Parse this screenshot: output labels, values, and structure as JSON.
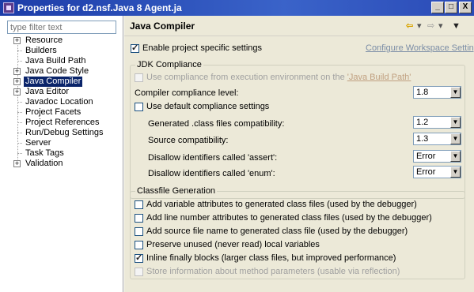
{
  "window": {
    "title": "Properties for d2.nsf.Java 8 Agent.ja",
    "buttons": {
      "minimize": "_",
      "maximize": "□",
      "close": "X"
    }
  },
  "left": {
    "filter_placeholder": "type filter text",
    "tree": [
      {
        "label": "Resource",
        "expandable": true,
        "selected": false
      },
      {
        "label": "Builders",
        "expandable": false,
        "selected": false
      },
      {
        "label": "Java Build Path",
        "expandable": false,
        "selected": false
      },
      {
        "label": "Java Code Style",
        "expandable": true,
        "selected": false
      },
      {
        "label": "Java Compiler",
        "expandable": true,
        "selected": true
      },
      {
        "label": "Java Editor",
        "expandable": true,
        "selected": false
      },
      {
        "label": "Javadoc Location",
        "expandable": false,
        "selected": false
      },
      {
        "label": "Project Facets",
        "expandable": false,
        "selected": false
      },
      {
        "label": "Project References",
        "expandable": false,
        "selected": false
      },
      {
        "label": "Run/Debug Settings",
        "expandable": false,
        "selected": false
      },
      {
        "label": "Server",
        "expandable": false,
        "selected": false
      },
      {
        "label": "Task Tags",
        "expandable": false,
        "selected": false
      },
      {
        "label": "Validation",
        "expandable": true,
        "selected": false
      }
    ]
  },
  "page": {
    "title": "Java Compiler",
    "nav": {
      "back": "⇦",
      "back_menu": "▾",
      "forward": "⇨",
      "forward_menu": "▾",
      "view_menu": "▼"
    },
    "enable_label": "Enable project specific settings",
    "configure_link": "Configure Workspace Settings...",
    "jdk": {
      "legend": "JDK Compliance",
      "use_compliance_prefix": "Use compliance from execution environment on the ",
      "use_compliance_link": "'Java Build Path'",
      "compliance_level_label": "Compiler compliance level:",
      "compliance_level_value": "1.8",
      "use_default_label": "Use default compliance settings",
      "generated_label": "Generated .class files compatibility:",
      "generated_value": "1.2",
      "source_label": "Source compatibility:",
      "source_value": "1.3",
      "assert_label": "Disallow identifiers called 'assert':",
      "assert_value": "Error",
      "enum_label": "Disallow identifiers called 'enum':",
      "enum_value": "Error"
    },
    "classfile": {
      "legend": "Classfile Generation",
      "opt1": "Add variable attributes to generated class files (used by the debugger)",
      "opt2": "Add line number attributes to generated class files (used by the debugger)",
      "opt3": "Add source file name to generated class file (used by the debugger)",
      "opt4": "Preserve unused (never read) local variables",
      "opt5": "Inline finally blocks (larger class files, but improved performance)",
      "opt6": "Store information about method parameters (usable via reflection)"
    }
  }
}
